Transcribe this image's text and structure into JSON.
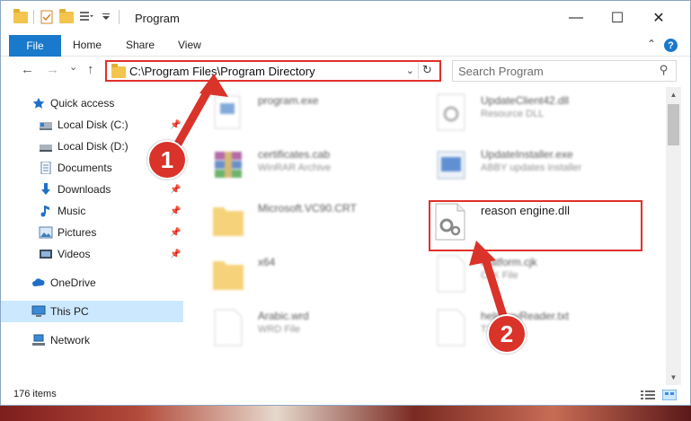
{
  "window": {
    "title": "Program",
    "minimize_glyph": "—",
    "maximize_glyph": "☐",
    "close_glyph": "✕"
  },
  "ribbon": {
    "file_tab": "File",
    "tabs": [
      "Home",
      "Share",
      "View"
    ],
    "help_glyph": "?",
    "collapse_glyph": "⌃"
  },
  "nav": {
    "back_glyph": "←",
    "forward_glyph": "→",
    "recent_glyph": "⌄",
    "up_glyph": "↑",
    "address": "C:\\Program Files\\Program Directory",
    "address_dropdown_glyph": "⌄",
    "refresh_glyph": "↻",
    "search_placeholder": "Search Program",
    "search_glyph": "⚲"
  },
  "sidebar": {
    "items": [
      {
        "label": "Quick access",
        "icon": "star-icon",
        "pinned": false
      },
      {
        "label": "Local Disk (C:)",
        "icon": "drive-icon",
        "pinned": true
      },
      {
        "label": "Local Disk (D:)",
        "icon": "drive-icon",
        "pinned": true
      },
      {
        "label": "Documents",
        "icon": "documents-icon",
        "pinned": true
      },
      {
        "label": "Downloads",
        "icon": "download-icon",
        "pinned": true
      },
      {
        "label": "Music",
        "icon": "music-icon",
        "pinned": true
      },
      {
        "label": "Pictures",
        "icon": "pictures-icon",
        "pinned": true
      },
      {
        "label": "Videos",
        "icon": "videos-icon",
        "pinned": true
      },
      {
        "label": "OneDrive",
        "icon": "cloud-icon",
        "pinned": false
      },
      {
        "label": "This PC",
        "icon": "computer-icon",
        "pinned": false,
        "selected": true
      },
      {
        "label": "Network",
        "icon": "network-icon",
        "pinned": false
      }
    ],
    "pin_glyph": "📌"
  },
  "files": [
    {
      "name": "program.exe",
      "type": "",
      "icon": "exe-icon"
    },
    {
      "name": "UpdateClient42.dll",
      "type": "Resource DLL",
      "icon": "dll-icon"
    },
    {
      "name": "certificates.cab",
      "type": "WinRAR Archive",
      "icon": "archive-icon"
    },
    {
      "name": "UpdateInstaller.exe",
      "type": "ABBY updates installer",
      "icon": "installer-icon"
    },
    {
      "name": "Microsoft.VC90.CRT",
      "type": "",
      "icon": "folder-icon"
    },
    {
      "name": "reason engine.dll",
      "type": "",
      "icon": "gear-dll-icon"
    },
    {
      "name": "x64",
      "type": "",
      "icon": "folder-icon"
    },
    {
      "name": "Platform.cjk",
      "type": "CJK File",
      "icon": "file-icon"
    },
    {
      "name": "Arabic.wrd",
      "type": "WRD File",
      "icon": "file-icon"
    },
    {
      "name": "helpKeyReader.txt",
      "type": "TXT File",
      "icon": "file-icon"
    }
  ],
  "status": {
    "item_count": "176 items"
  },
  "annotations": {
    "step1": "1",
    "step2": "2",
    "highlight_color": "#e0302a"
  },
  "colors": {
    "accent": "#1979ca",
    "selection": "#cce8ff"
  }
}
